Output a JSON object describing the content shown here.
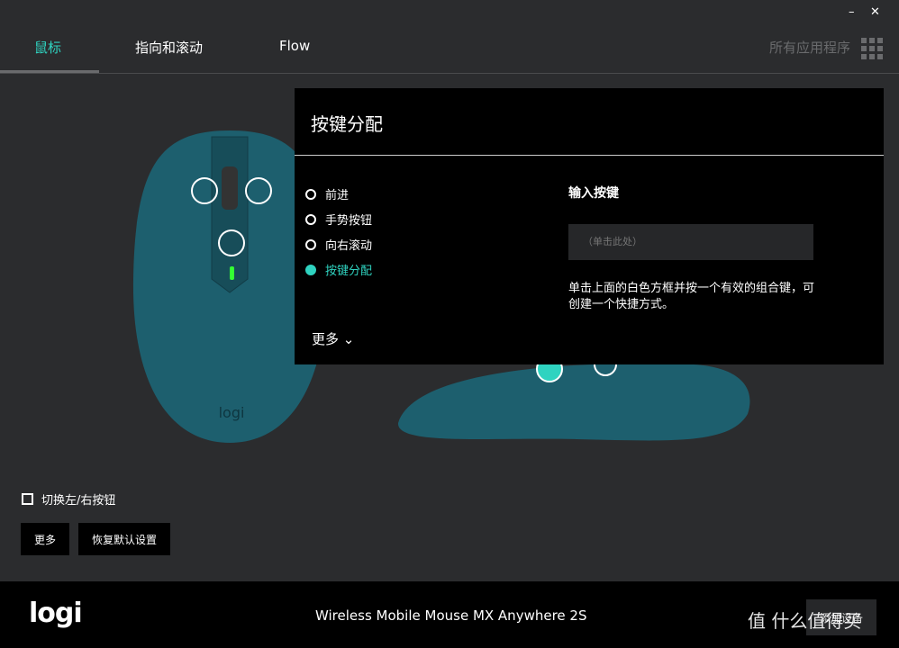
{
  "window": {
    "minimize": "–",
    "close": "✕"
  },
  "tabs": [
    {
      "label": "鼠标",
      "active": true
    },
    {
      "label": "指向和滚动"
    },
    {
      "label": "Flow"
    }
  ],
  "all_apps": "所有应用程序",
  "panel": {
    "title": "按键分配",
    "options": [
      {
        "label": "前进"
      },
      {
        "label": "手势按钮"
      },
      {
        "label": "向右滚动"
      },
      {
        "label": "按键分配",
        "selected": true
      }
    ],
    "more": "更多",
    "input_label": "输入按键",
    "input_placeholder": "（单击此处）",
    "hint": "单击上面的白色方框并按一个有效的组合键，可创建一个快捷方式。"
  },
  "swap_buttons": {
    "label": "切换左/右按钮",
    "checked": false
  },
  "buttons": {
    "more": "更多",
    "restore": "恢复默认设置"
  },
  "footer": {
    "logo": "logi",
    "device": "Wireless Mobile Mouse MX Anywhere 2S",
    "add_device": "添加设备",
    "watermark": "值 什么值得买"
  },
  "mouse": {
    "logo": "logi"
  },
  "colors": {
    "accent": "#2fd3c0",
    "mouse": "#1d5f6e"
  }
}
